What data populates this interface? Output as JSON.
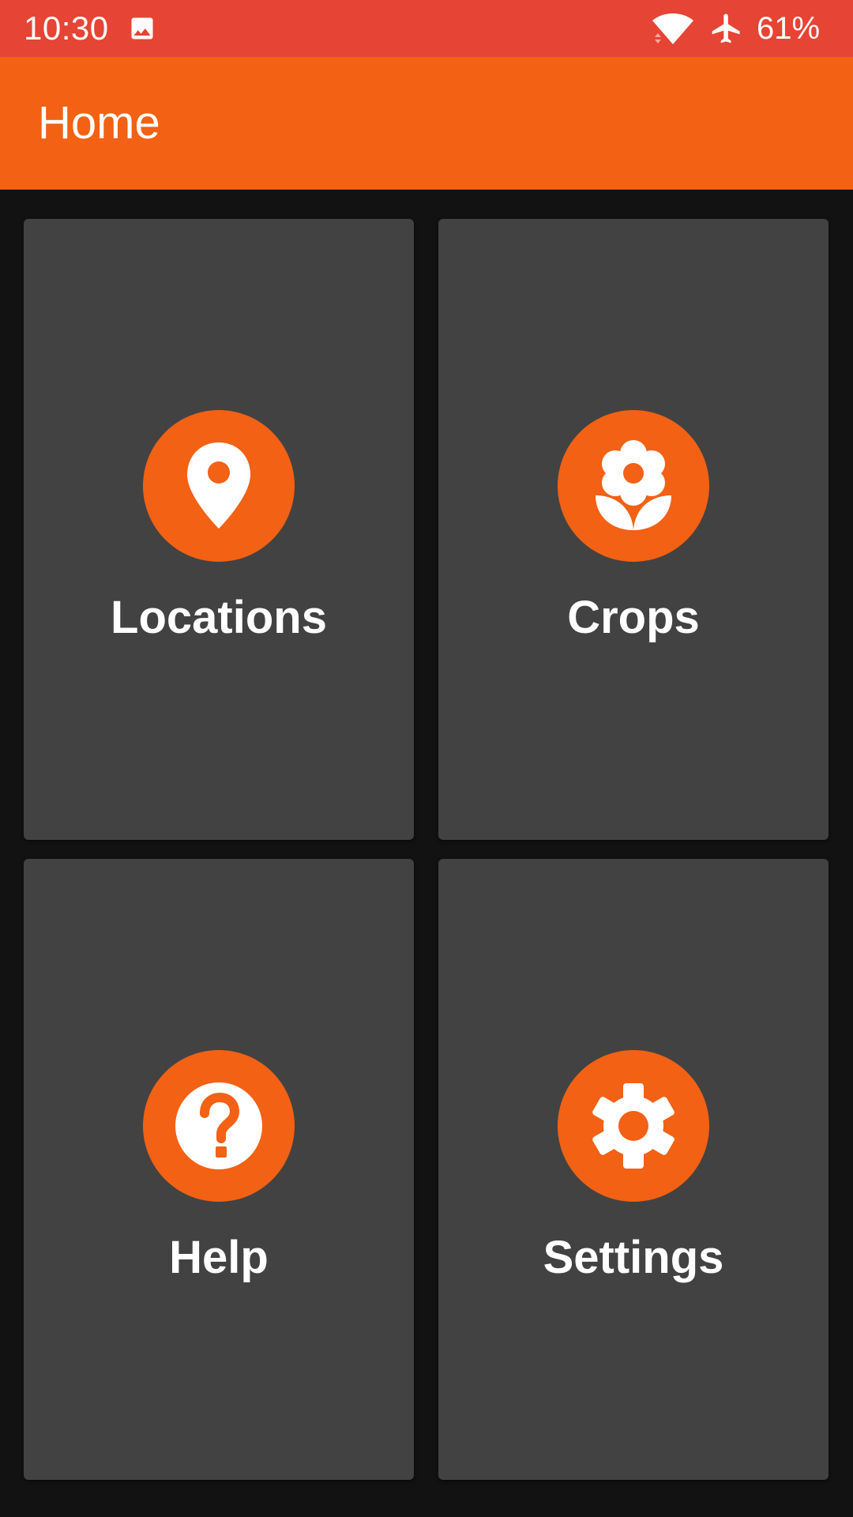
{
  "status_bar": {
    "time": "10:30",
    "battery": "61%",
    "icons": [
      "gallery-icon",
      "wifi-icon",
      "airplane-icon"
    ],
    "color": "#e64434"
  },
  "app_bar": {
    "title": "Home",
    "color": "#f26114"
  },
  "tiles": [
    {
      "label": "Locations",
      "icon": "location-pin-icon"
    },
    {
      "label": "Crops",
      "icon": "flower-icon"
    },
    {
      "label": "Help",
      "icon": "help-icon"
    },
    {
      "label": "Settings",
      "icon": "gear-icon"
    }
  ],
  "colors": {
    "accent": "#f26114",
    "tile_background": "#424242",
    "page_background": "#121212"
  }
}
